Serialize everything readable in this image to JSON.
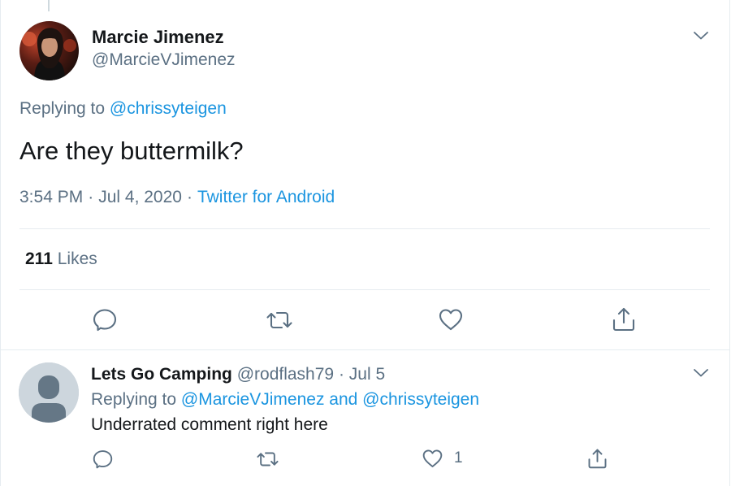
{
  "main_tweet": {
    "author_name": "Marcie Jimenez",
    "author_handle": "@MarcieVJimenez",
    "replying_prefix": "Replying to",
    "replying_to": "@chrissyteigen",
    "text": "Are they buttermilk?",
    "time": "3:54 PM",
    "date": "Jul 4, 2020",
    "source": "Twitter for Android",
    "separator": "·",
    "likes_count": "211",
    "likes_label": "Likes"
  },
  "reply_tweet": {
    "author_name": "Lets Go Camping",
    "author_handle": "@rodflash79",
    "separator": "·",
    "date": "Jul 5",
    "replying_prefix": "Replying to",
    "replying_to_1": "@MarcieVJimenez",
    "replying_and": "and",
    "replying_to_2": "@chrissyteigen",
    "text": "Underrated comment right here",
    "like_count": "1"
  },
  "icons": {
    "caret": "chevron-down-icon",
    "reply": "reply-icon",
    "retweet": "retweet-icon",
    "like": "heart-icon",
    "share": "share-icon"
  },
  "colors": {
    "link": "#1b95e0",
    "muted": "#5b7083",
    "text": "#14171a",
    "divider": "#e6ecf0"
  }
}
